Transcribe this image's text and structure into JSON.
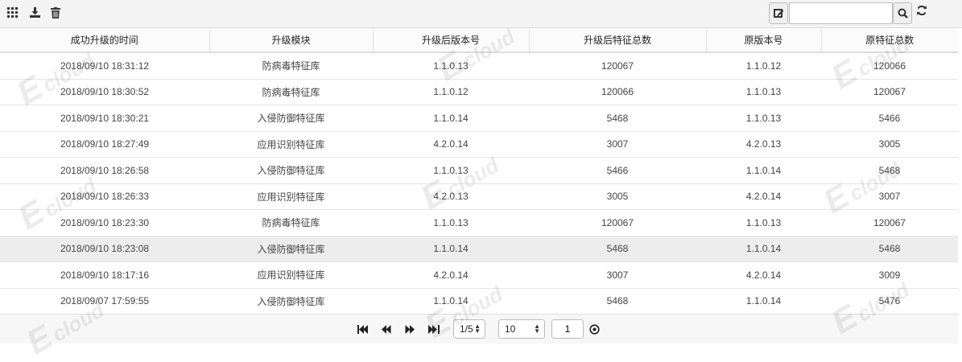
{
  "toolbar": {
    "icons": [
      "grid-icon",
      "export-icon",
      "delete-icon"
    ]
  },
  "search": {
    "value": "",
    "placeholder": ""
  },
  "table": {
    "columns": [
      "成功升级的时间",
      "升级模块",
      "升级后版本号",
      "升级后特征总数",
      "原版本号",
      "原特征总数"
    ],
    "rows": [
      [
        "2018/09/10 18:31:12",
        "防病毒特征库",
        "1.1.0.13",
        "120067",
        "1.1.0.12",
        "120066"
      ],
      [
        "2018/09/10 18:30:52",
        "防病毒特征库",
        "1.1.0.12",
        "120066",
        "1.1.0.13",
        "120067"
      ],
      [
        "2018/09/10 18:30:21",
        "入侵防御特征库",
        "1.1.0.14",
        "5468",
        "1.1.0.13",
        "5466"
      ],
      [
        "2018/09/10 18:27:49",
        "应用识别特征库",
        "4.2.0.14",
        "3007",
        "4.2.0.13",
        "3005"
      ],
      [
        "2018/09/10 18:26:58",
        "入侵防御特征库",
        "1.1.0.13",
        "5466",
        "1.1.0.14",
        "5468"
      ],
      [
        "2018/09/10 18:26:33",
        "应用识别特征库",
        "4.2.0.13",
        "3005",
        "4.2.0.14",
        "3007"
      ],
      [
        "2018/09/10 18:23:30",
        "防病毒特征库",
        "1.1.0.13",
        "120067",
        "1.1.0.13",
        "120067"
      ],
      [
        "2018/09/10 18:23:08",
        "入侵防御特征库",
        "1.1.0.14",
        "5468",
        "1.1.0.14",
        "5468"
      ],
      [
        "2018/09/10 18:17:16",
        "应用识别特征库",
        "4.2.0.14",
        "3007",
        "4.2.0.14",
        "3009"
      ],
      [
        "2018/09/07 17:59:55",
        "入侵防御特征库",
        "1.1.0.14",
        "5468",
        "1.1.0.14",
        "5476"
      ]
    ],
    "highlighted_row": 7
  },
  "pager": {
    "page_select": "1/5",
    "page_size": "10",
    "page_input": "1"
  },
  "watermark": {
    "letter": "E",
    "text": "cloud"
  }
}
